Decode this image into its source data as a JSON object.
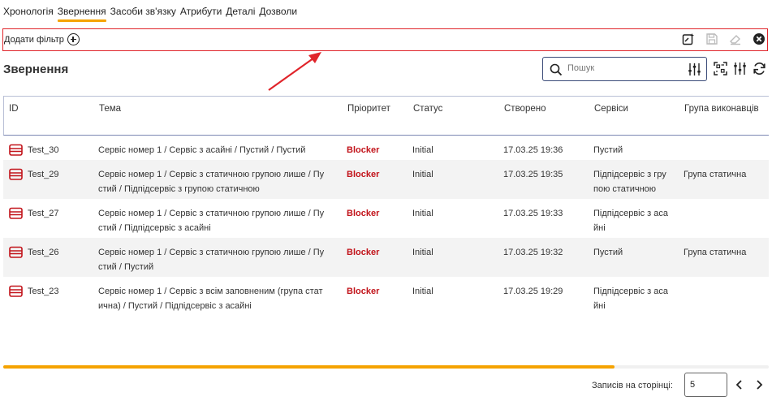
{
  "tabs": [
    "Хронологія",
    "Звернення",
    "Засоби зв'язку",
    "Атрибути",
    "Деталі",
    "Дозволи"
  ],
  "active_tab": "Звернення",
  "filter": {
    "add_label": "Додати фільтр"
  },
  "page_title": "Звернення",
  "search": {
    "placeholder": "Пошук",
    "value": ""
  },
  "columns": [
    "ID",
    "Тема",
    "Пріоритет",
    "Статус",
    "Створено",
    "Сервіси",
    "Група виконавців"
  ],
  "rows": [
    {
      "id": "Test_30",
      "topic": [
        "Сервіс номер 1 / Сервіс з асайні / Пустий / Пустий"
      ],
      "priority": "Blocker",
      "status": "Initial",
      "created": "17.03.25 19:36",
      "services": [
        "Пустий"
      ],
      "group": ""
    },
    {
      "id": "Test_29",
      "topic": [
        "Сервіс номер 1 / Сервіс з статичною групою лише / Пу",
        "стий / Підпідсервіс з групою статичною"
      ],
      "priority": "Blocker",
      "status": "Initial",
      "created": "17.03.25 19:35",
      "services": [
        "Підпідсервіс з гру",
        "пою статичною"
      ],
      "group": "Група статична"
    },
    {
      "id": "Test_27",
      "topic": [
        "Сервіс номер 1 / Сервіс з статичною групою лише / Пу",
        "стий / Підпідсервіс з асайні"
      ],
      "priority": "Blocker",
      "status": "Initial",
      "created": "17.03.25 19:33",
      "services": [
        "Підпідсервіс з аса",
        "йні"
      ],
      "group": ""
    },
    {
      "id": "Test_26",
      "topic": [
        "Сервіс номер 1 / Сервіс з статичною групою лише / Пу",
        "стий / Пустий"
      ],
      "priority": "Blocker",
      "status": "Initial",
      "created": "17.03.25 19:32",
      "services": [
        "Пустий"
      ],
      "group": "Група статична"
    },
    {
      "id": "Test_23",
      "topic": [
        "Сервіс номер 1 / Сервіс з всім заповненим (група стат",
        "ична) / Пустий / Підпідсервіс з асайні"
      ],
      "priority": "Blocker",
      "status": "Initial",
      "created": "17.03.25 19:29",
      "services": [
        "Підпідсервіс з аса",
        "йні"
      ],
      "group": ""
    }
  ],
  "pager": {
    "label": "Записів на сторінці:",
    "page_size": "5"
  },
  "colors": {
    "accent": "#f5a300",
    "highlight_border": "#e0242a",
    "priority_blocker": "#c2141b",
    "row_alt": "#f3f3f3"
  },
  "icons": [
    "add-filter-icon",
    "save-filter-icon",
    "save-icon",
    "eraser-icon",
    "close-circle-icon",
    "search-icon",
    "sliders-icon",
    "qr-icon",
    "columns-icon",
    "refresh-icon",
    "folder-icon",
    "chevron-left-icon",
    "chevron-right-icon"
  ]
}
